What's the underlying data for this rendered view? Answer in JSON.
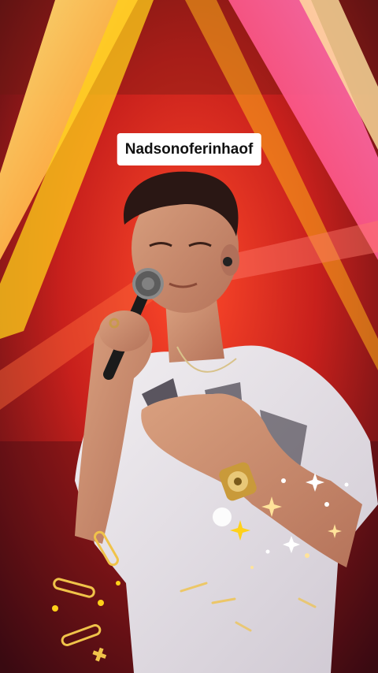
{
  "video": {
    "text_overlay": "Nadsonoferinhaof"
  },
  "colors": {
    "stage_red": "#d2231e",
    "stage_yellow": "#ffd11a",
    "stage_pink": "#f05aa0",
    "shirt": "#e9e6ea",
    "skin": "#c88a6b",
    "hair": "#2a1714",
    "sparkle": "#ffe39a"
  },
  "icons": [
    "sparkle-icon",
    "star-icon"
  ]
}
